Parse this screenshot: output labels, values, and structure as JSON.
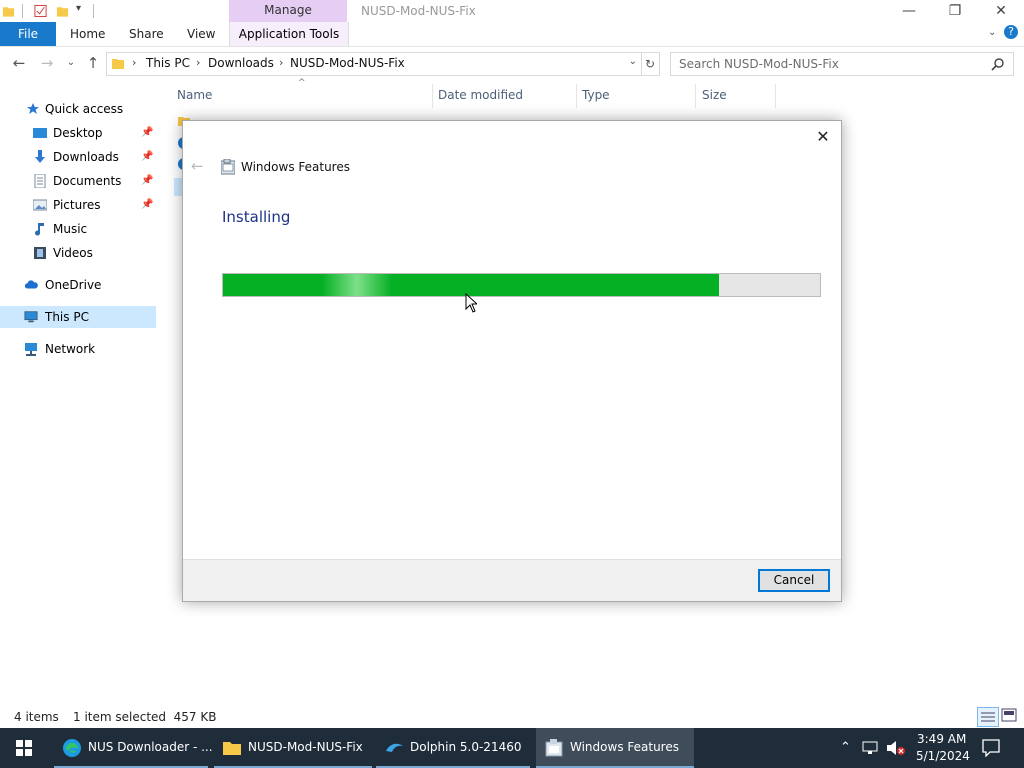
{
  "titlebar": {
    "manage_tab": "Manage",
    "window_title": "NUSD-Mod-NUS-Fix"
  },
  "ribbon": {
    "file": "File",
    "home": "Home",
    "share": "Share",
    "view": "View",
    "app_tools": "Application Tools"
  },
  "address": {
    "this_pc": "This PC",
    "downloads": "Downloads",
    "folder": "NUSD-Mod-NUS-Fix",
    "search_placeholder": "Search NUSD-Mod-NUS-Fix"
  },
  "sidebar": {
    "quick_access": "Quick access",
    "desktop": "Desktop",
    "downloads": "Downloads",
    "documents": "Documents",
    "pictures": "Pictures",
    "music": "Music",
    "videos": "Videos",
    "onedrive": "OneDrive",
    "this_pc": "This PC",
    "network": "Network"
  },
  "columns": {
    "name": "Name",
    "date_modified": "Date modified",
    "type": "Type",
    "size": "Size"
  },
  "status": {
    "items": "4 items",
    "selected": "1 item selected  457 KB"
  },
  "dialog": {
    "title": "Windows Features",
    "heading": "Installing",
    "progress_fraction": 0.83,
    "cancel": "Cancel"
  },
  "taskbar": {
    "items": [
      {
        "label": "NUS Downloader - ..."
      },
      {
        "label": "NUSD-Mod-NUS-Fix"
      },
      {
        "label": "Dolphin 5.0-21460"
      },
      {
        "label": "Windows Features"
      }
    ],
    "time": "3:49 AM",
    "date": "5/1/2024"
  },
  "colors": {
    "accent": "#1979ca",
    "progress_green": "#06b025",
    "taskbar_bg": "#1f2c3a"
  }
}
